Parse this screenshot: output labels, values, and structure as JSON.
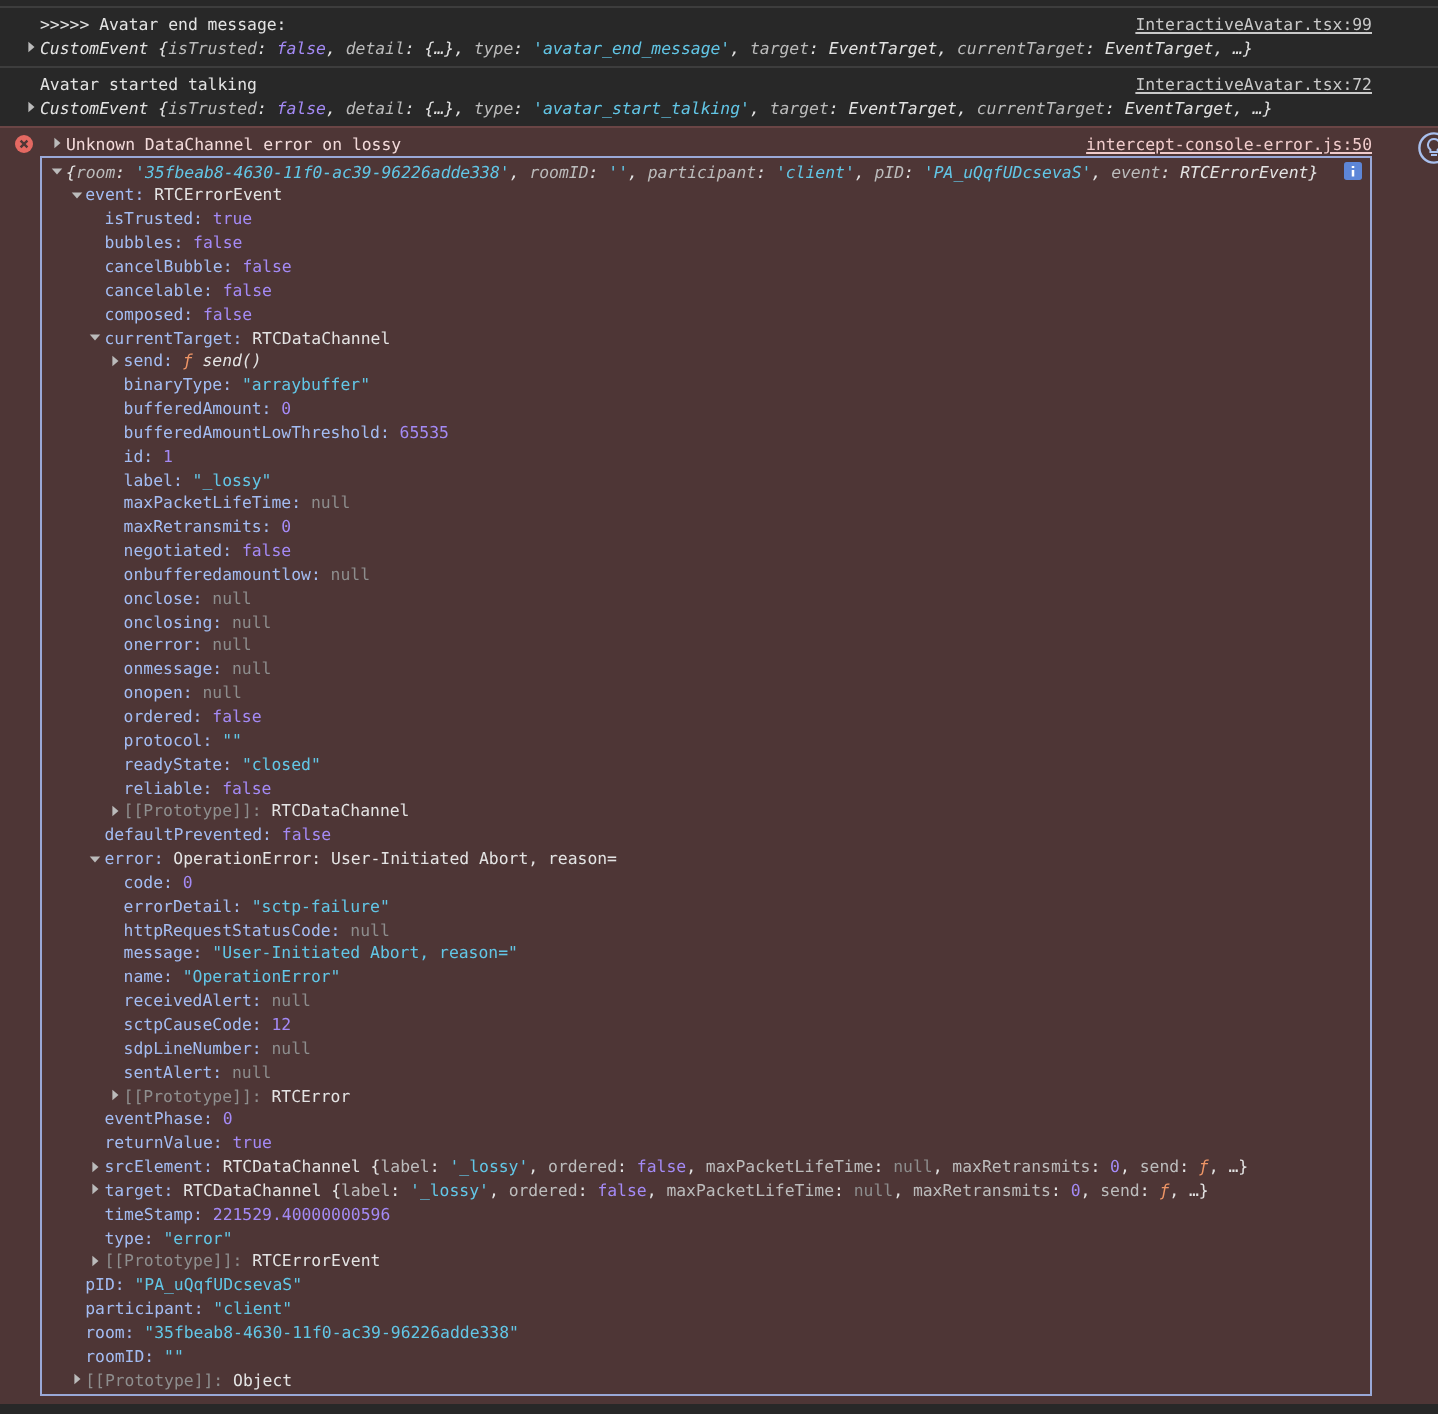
{
  "console": {
    "messages": [
      {
        "kind": "log",
        "text": ">>>>> Avatar end message:",
        "source": "InteractiveAvatar.tsx:99",
        "object": {
          "expanded": false,
          "italic": true,
          "tokens": [
            {
              "text": "CustomEvent ",
              "kind": "obj"
            },
            {
              "text": "{",
              "kind": "punct"
            },
            {
              "text": "isTrusted",
              "kind": "pkey"
            },
            {
              "text": ": ",
              "kind": "punct"
            },
            {
              "text": "false",
              "kind": "bool"
            },
            {
              "text": ", ",
              "kind": "punct"
            },
            {
              "text": "detail",
              "kind": "pkey"
            },
            {
              "text": ": ",
              "kind": "punct"
            },
            {
              "text": "{…}",
              "kind": "obj"
            },
            {
              "text": ", ",
              "kind": "punct"
            },
            {
              "text": "type",
              "kind": "pkey"
            },
            {
              "text": ": ",
              "kind": "punct"
            },
            {
              "text": "'avatar_end_message'",
              "kind": "str"
            },
            {
              "text": ", ",
              "kind": "punct"
            },
            {
              "text": "target",
              "kind": "pkey"
            },
            {
              "text": ": ",
              "kind": "punct"
            },
            {
              "text": "EventTarget",
              "kind": "obj"
            },
            {
              "text": ", ",
              "kind": "punct"
            },
            {
              "text": "currentTarget",
              "kind": "pkey"
            },
            {
              "text": ": ",
              "kind": "punct"
            },
            {
              "text": "EventTarget",
              "kind": "obj"
            },
            {
              "text": ", …}",
              "kind": "punct"
            }
          ]
        }
      },
      {
        "kind": "log",
        "text": "Avatar started talking",
        "source": "InteractiveAvatar.tsx:72",
        "object": {
          "expanded": false,
          "italic": true,
          "tokens": [
            {
              "text": "CustomEvent ",
              "kind": "obj"
            },
            {
              "text": "{",
              "kind": "punct"
            },
            {
              "text": "isTrusted",
              "kind": "pkey"
            },
            {
              "text": ": ",
              "kind": "punct"
            },
            {
              "text": "false",
              "kind": "bool"
            },
            {
              "text": ", ",
              "kind": "punct"
            },
            {
              "text": "detail",
              "kind": "pkey"
            },
            {
              "text": ": ",
              "kind": "punct"
            },
            {
              "text": "{…}",
              "kind": "obj"
            },
            {
              "text": ", ",
              "kind": "punct"
            },
            {
              "text": "type",
              "kind": "pkey"
            },
            {
              "text": ": ",
              "kind": "punct"
            },
            {
              "text": "'avatar_start_talking'",
              "kind": "str"
            },
            {
              "text": ", ",
              "kind": "punct"
            },
            {
              "text": "target",
              "kind": "pkey"
            },
            {
              "text": ": ",
              "kind": "punct"
            },
            {
              "text": "EventTarget",
              "kind": "obj"
            },
            {
              "text": ", ",
              "kind": "punct"
            },
            {
              "text": "currentTarget",
              "kind": "pkey"
            },
            {
              "text": ": ",
              "kind": "punct"
            },
            {
              "text": "EventTarget",
              "kind": "obj"
            },
            {
              "text": ", …}",
              "kind": "punct"
            }
          ]
        }
      },
      {
        "kind": "error",
        "text": "Unknown DataChannel error on lossy",
        "source": "intercept-console-error.js:50",
        "expanded": false,
        "object": {
          "expanded": true,
          "italic": true,
          "tokens": [
            {
              "text": "{",
              "kind": "punct"
            },
            {
              "text": "room",
              "kind": "pkey"
            },
            {
              "text": ": ",
              "kind": "punct"
            },
            {
              "text": "'35fbeab8-4630-11f0-ac39-96226adde338'",
              "kind": "str"
            },
            {
              "text": ", ",
              "kind": "punct"
            },
            {
              "text": "roomID",
              "kind": "pkey"
            },
            {
              "text": ": ",
              "kind": "punct"
            },
            {
              "text": "''",
              "kind": "str"
            },
            {
              "text": ", ",
              "kind": "punct"
            },
            {
              "text": "participant",
              "kind": "pkey"
            },
            {
              "text": ": ",
              "kind": "punct"
            },
            {
              "text": "'client'",
              "kind": "str"
            },
            {
              "text": ", ",
              "kind": "punct"
            },
            {
              "text": "pID",
              "kind": "pkey"
            },
            {
              "text": ": ",
              "kind": "punct"
            },
            {
              "text": "'PA_uQqfUDcsevaS'",
              "kind": "str"
            },
            {
              "text": ", ",
              "kind": "punct"
            },
            {
              "text": "event",
              "kind": "pkey"
            },
            {
              "text": ": ",
              "kind": "punct"
            },
            {
              "text": "RTCErrorEvent",
              "kind": "obj"
            },
            {
              "text": "}",
              "kind": "punct"
            }
          ],
          "children": [
            {
              "key": "event:",
              "kind": "obj",
              "value": "RTCErrorEvent",
              "expanded": true,
              "children": [
                {
                  "key": "isTrusted:",
                  "kind": "bool",
                  "value": "true"
                },
                {
                  "key": "bubbles:",
                  "kind": "bool",
                  "value": "false"
                },
                {
                  "key": "cancelBubble:",
                  "kind": "bool",
                  "value": "false"
                },
                {
                  "key": "cancelable:",
                  "kind": "bool",
                  "value": "false"
                },
                {
                  "key": "composed:",
                  "kind": "bool",
                  "value": "false"
                },
                {
                  "key": "currentTarget:",
                  "kind": "obj",
                  "value": "RTCDataChannel",
                  "expanded": true,
                  "children": [
                    {
                      "key": "send:",
                      "kind": "preview",
                      "expanded": false,
                      "tokens": [
                        {
                          "text": "ƒ ",
                          "kind": "fn"
                        },
                        {
                          "text": "send()",
                          "kind": "fname"
                        }
                      ]
                    },
                    {
                      "key": "binaryType:",
                      "kind": "str",
                      "value": "\"arraybuffer\""
                    },
                    {
                      "key": "bufferedAmount:",
                      "kind": "num",
                      "value": "0"
                    },
                    {
                      "key": "bufferedAmountLowThreshold:",
                      "kind": "num",
                      "value": "65535"
                    },
                    {
                      "key": "id:",
                      "kind": "num",
                      "value": "1"
                    },
                    {
                      "key": "label:",
                      "kind": "str",
                      "value": "\"_lossy\""
                    },
                    {
                      "key": "maxPacketLifeTime:",
                      "kind": "null",
                      "value": "null"
                    },
                    {
                      "key": "maxRetransmits:",
                      "kind": "num",
                      "value": "0"
                    },
                    {
                      "key": "negotiated:",
                      "kind": "bool",
                      "value": "false"
                    },
                    {
                      "key": "onbufferedamountlow:",
                      "kind": "null",
                      "value": "null"
                    },
                    {
                      "key": "onclose:",
                      "kind": "null",
                      "value": "null"
                    },
                    {
                      "key": "onclosing:",
                      "kind": "null",
                      "value": "null"
                    },
                    {
                      "key": "onerror:",
                      "kind": "null",
                      "value": "null"
                    },
                    {
                      "key": "onmessage:",
                      "kind": "null",
                      "value": "null"
                    },
                    {
                      "key": "onopen:",
                      "kind": "null",
                      "value": "null"
                    },
                    {
                      "key": "ordered:",
                      "kind": "bool",
                      "value": "false"
                    },
                    {
                      "key": "protocol:",
                      "kind": "str",
                      "value": "\"\""
                    },
                    {
                      "key": "readyState:",
                      "kind": "str",
                      "value": "\"closed\""
                    },
                    {
                      "key": "reliable:",
                      "kind": "bool",
                      "value": "false"
                    },
                    {
                      "key": "[[Prototype]]:",
                      "kind": "proto",
                      "value": "RTCDataChannel",
                      "expanded": false
                    }
                  ]
                },
                {
                  "key": "defaultPrevented:",
                  "kind": "bool",
                  "value": "false"
                },
                {
                  "key": "error:",
                  "kind": "obj",
                  "value": "OperationError: User-Initiated Abort, reason=",
                  "expanded": true,
                  "children": [
                    {
                      "key": "code:",
                      "kind": "num",
                      "value": "0"
                    },
                    {
                      "key": "errorDetail:",
                      "kind": "str",
                      "value": "\"sctp-failure\""
                    },
                    {
                      "key": "httpRequestStatusCode:",
                      "kind": "null",
                      "value": "null"
                    },
                    {
                      "key": "message:",
                      "kind": "str",
                      "value": "\"User-Initiated Abort, reason=\""
                    },
                    {
                      "key": "name:",
                      "kind": "str",
                      "value": "\"OperationError\""
                    },
                    {
                      "key": "receivedAlert:",
                      "kind": "null",
                      "value": "null"
                    },
                    {
                      "key": "sctpCauseCode:",
                      "kind": "num",
                      "value": "12"
                    },
                    {
                      "key": "sdpLineNumber:",
                      "kind": "null",
                      "value": "null"
                    },
                    {
                      "key": "sentAlert:",
                      "kind": "null",
                      "value": "null"
                    },
                    {
                      "key": "[[Prototype]]:",
                      "kind": "proto",
                      "value": "RTCError",
                      "expanded": false
                    }
                  ]
                },
                {
                  "key": "eventPhase:",
                  "kind": "num",
                  "value": "0"
                },
                {
                  "key": "returnValue:",
                  "kind": "bool",
                  "value": "true"
                },
                {
                  "key": "srcElement:",
                  "kind": "preview",
                  "expanded": false,
                  "tokens": [
                    {
                      "text": "RTCDataChannel ",
                      "kind": "obj"
                    },
                    {
                      "text": "{",
                      "kind": "punct"
                    },
                    {
                      "text": "label",
                      "kind": "pkey"
                    },
                    {
                      "text": ": ",
                      "kind": "punct"
                    },
                    {
                      "text": "'_lossy'",
                      "kind": "str"
                    },
                    {
                      "text": ", ",
                      "kind": "punct"
                    },
                    {
                      "text": "ordered",
                      "kind": "pkey"
                    },
                    {
                      "text": ": ",
                      "kind": "punct"
                    },
                    {
                      "text": "false",
                      "kind": "bool"
                    },
                    {
                      "text": ", ",
                      "kind": "punct"
                    },
                    {
                      "text": "maxPacketLifeTime",
                      "kind": "pkey"
                    },
                    {
                      "text": ": ",
                      "kind": "punct"
                    },
                    {
                      "text": "null",
                      "kind": "null"
                    },
                    {
                      "text": ", ",
                      "kind": "punct"
                    },
                    {
                      "text": "maxRetransmits",
                      "kind": "pkey"
                    },
                    {
                      "text": ": ",
                      "kind": "punct"
                    },
                    {
                      "text": "0",
                      "kind": "num"
                    },
                    {
                      "text": ", ",
                      "kind": "punct"
                    },
                    {
                      "text": "send",
                      "kind": "pkey"
                    },
                    {
                      "text": ": ",
                      "kind": "punct"
                    },
                    {
                      "text": "ƒ",
                      "kind": "fn"
                    },
                    {
                      "text": ", …}",
                      "kind": "punct"
                    }
                  ]
                },
                {
                  "key": "target:",
                  "kind": "preview",
                  "expanded": false,
                  "tokens": [
                    {
                      "text": "RTCDataChannel ",
                      "kind": "obj"
                    },
                    {
                      "text": "{",
                      "kind": "punct"
                    },
                    {
                      "text": "label",
                      "kind": "pkey"
                    },
                    {
                      "text": ": ",
                      "kind": "punct"
                    },
                    {
                      "text": "'_lossy'",
                      "kind": "str"
                    },
                    {
                      "text": ", ",
                      "kind": "punct"
                    },
                    {
                      "text": "ordered",
                      "kind": "pkey"
                    },
                    {
                      "text": ": ",
                      "kind": "punct"
                    },
                    {
                      "text": "false",
                      "kind": "bool"
                    },
                    {
                      "text": ", ",
                      "kind": "punct"
                    },
                    {
                      "text": "maxPacketLifeTime",
                      "kind": "pkey"
                    },
                    {
                      "text": ": ",
                      "kind": "punct"
                    },
                    {
                      "text": "null",
                      "kind": "null"
                    },
                    {
                      "text": ", ",
                      "kind": "punct"
                    },
                    {
                      "text": "maxRetransmits",
                      "kind": "pkey"
                    },
                    {
                      "text": ": ",
                      "kind": "punct"
                    },
                    {
                      "text": "0",
                      "kind": "num"
                    },
                    {
                      "text": ", ",
                      "kind": "punct"
                    },
                    {
                      "text": "send",
                      "kind": "pkey"
                    },
                    {
                      "text": ": ",
                      "kind": "punct"
                    },
                    {
                      "text": "ƒ",
                      "kind": "fn"
                    },
                    {
                      "text": ", …}",
                      "kind": "punct"
                    }
                  ]
                },
                {
                  "key": "timeStamp:",
                  "kind": "num",
                  "value": "221529.40000000596"
                },
                {
                  "key": "type:",
                  "kind": "str",
                  "value": "\"error\""
                },
                {
                  "key": "[[Prototype]]:",
                  "kind": "proto",
                  "value": "RTCErrorEvent",
                  "expanded": false
                }
              ]
            },
            {
              "key": "pID:",
              "kind": "str",
              "value": "\"PA_uQqfUDcsevaS\""
            },
            {
              "key": "participant:",
              "kind": "str",
              "value": "\"client\""
            },
            {
              "key": "room:",
              "kind": "str",
              "value": "\"35fbeab8-4630-11f0-ac39-96226adde338\""
            },
            {
              "key": "roomID:",
              "kind": "str",
              "value": "\"\""
            },
            {
              "key": "[[Prototype]]:",
              "kind": "proto",
              "value": "Object",
              "expanded": false
            }
          ]
        }
      }
    ]
  }
}
